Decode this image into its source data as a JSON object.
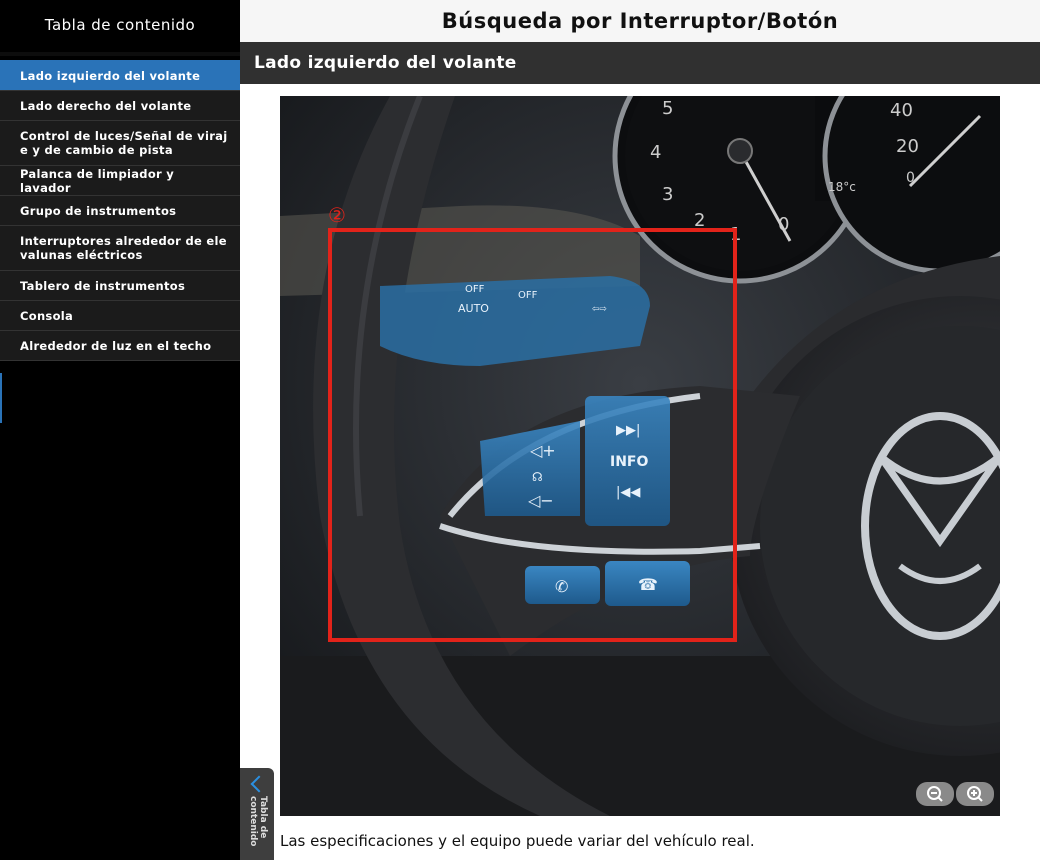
{
  "sidebar": {
    "title": "Tabla de contenido",
    "items": [
      {
        "label": "Lado izquierdo del volante",
        "active": true
      },
      {
        "label": "Lado derecho del volante"
      },
      {
        "label": "Control de luces/Señal de viraj e y de cambio de pista"
      },
      {
        "label": "Palanca de limpiador y lavador"
      },
      {
        "label": "Grupo de instrumentos"
      },
      {
        "label": "Interruptores alrededor de ele valunas eléctricos"
      },
      {
        "label": "Tablero de instrumentos"
      },
      {
        "label": "Consola"
      },
      {
        "label": "Alrededor de luz en el techo"
      }
    ]
  },
  "header": {
    "title": "Búsqueda por Interruptor/Botón",
    "subtitle": "Lado izquierdo del volante"
  },
  "figure": {
    "marker": "②",
    "lever_labels": {
      "off1": "OFF",
      "auto": "AUTO",
      "off2": "OFF"
    },
    "button_labels": {
      "info": "INFO"
    },
    "gauge_left_numbers": [
      "5",
      "4",
      "3",
      "2",
      "1",
      "0"
    ],
    "gauge_right_numbers": [
      "40",
      "20",
      "0",
      "0"
    ],
    "temperature": "18°c",
    "highlight_color": "#e2231a",
    "button_tint": "#2a6ea3"
  },
  "caption": "Las especificaciones y el equipo puede variar del vehículo real.",
  "toc_tab": {
    "label": "Tabla de contenido"
  },
  "zoom": {
    "out_icon": "zoom-out-icon",
    "in_icon": "zoom-in-icon"
  }
}
